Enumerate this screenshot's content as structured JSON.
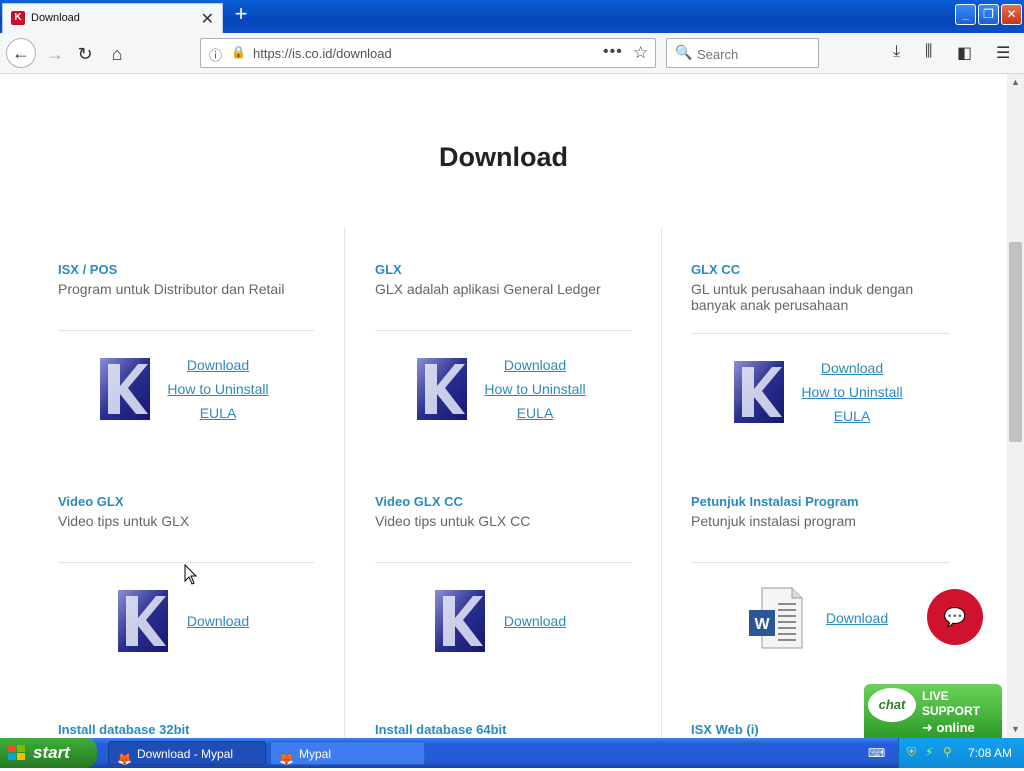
{
  "browser": {
    "tab_title": "Download",
    "new_tab_symbol": "+",
    "url": "https://is.co.id/download",
    "search_placeholder": "Search"
  },
  "page": {
    "heading": "Download",
    "cards": [
      {
        "title": "ISX / POS",
        "desc": "Program untuk Distributor dan Retail",
        "links": [
          "Download",
          "How to Uninstall",
          "EULA"
        ]
      },
      {
        "title": "GLX",
        "desc": "GLX adalah aplikasi General Ledger",
        "links": [
          "Download",
          "How to Uninstall",
          "EULA"
        ]
      },
      {
        "title": "GLX CC",
        "desc": "GL untuk perusahaan induk dengan banyak anak perusahaan",
        "links": [
          "Download",
          "How to Uninstall",
          "EULA"
        ]
      },
      {
        "title": "Video GLX",
        "desc": "Video tips untuk GLX",
        "links": [
          "Download"
        ]
      },
      {
        "title": "Video GLX CC",
        "desc": "Video tips untuk GLX CC",
        "links": [
          "Download"
        ]
      },
      {
        "title": "Petunjuk Instalasi Program",
        "desc": "Petunjuk instalasi program",
        "links": [
          "Download"
        ]
      },
      {
        "title": "Install database 32bit"
      },
      {
        "title": "Install database 64bit"
      },
      {
        "title": "ISX Web (i)"
      }
    ]
  },
  "widgets": {
    "chat_bubble": "chat",
    "live_support_line1": "LIVE",
    "live_support_line2": "SUPPORT",
    "live_support_status": "online"
  },
  "taskbar": {
    "start_label": "start",
    "tasks": [
      "Download - Mypal",
      "Mypal"
    ],
    "clock": "7:08 AM"
  },
  "colors": {
    "link": "#2a8bc0",
    "heading": "#222222",
    "chat_red": "#d0122f",
    "live_green": "#2e9c29"
  }
}
